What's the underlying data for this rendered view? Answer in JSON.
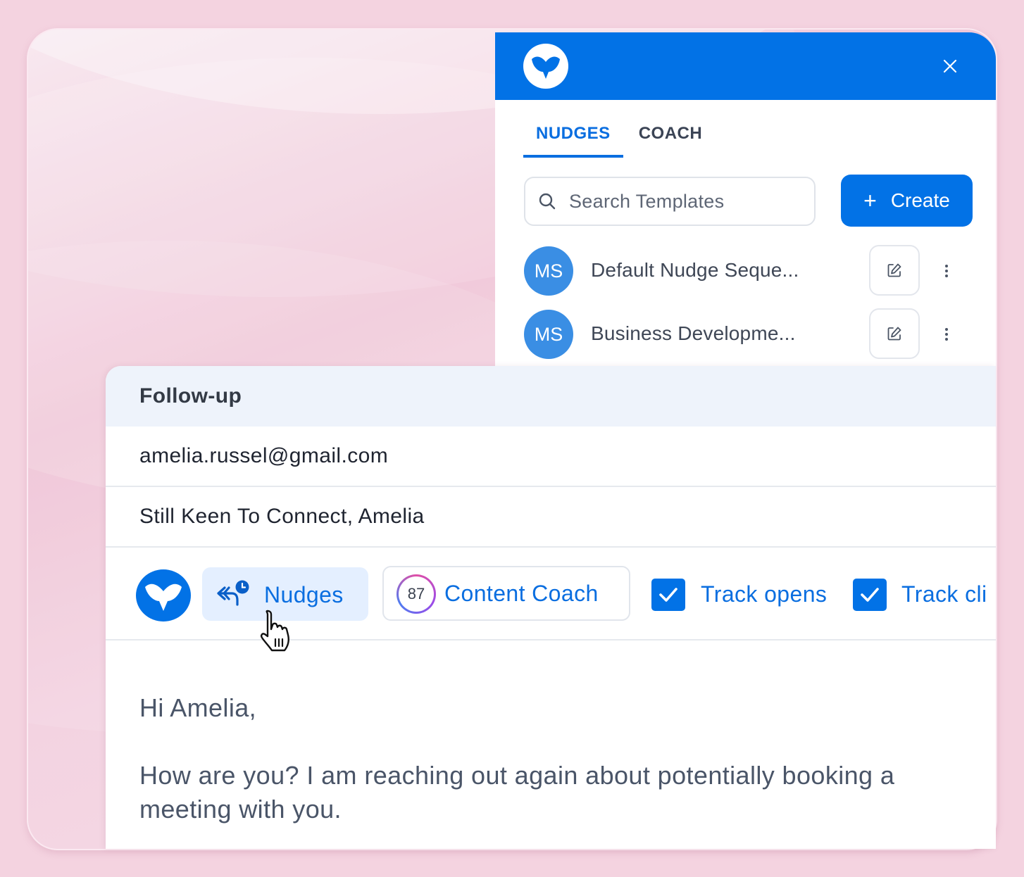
{
  "panel": {
    "close_icon": "close-icon",
    "tabs": [
      {
        "label": "NUDGES",
        "active": true
      },
      {
        "label": "COACH",
        "active": false
      }
    ],
    "search": {
      "placeholder": "Search Templates",
      "icon": "search-icon"
    },
    "create_button": {
      "plus": "+",
      "label": "Create"
    },
    "templates": [
      {
        "initials": "MS",
        "name": "Default Nudge Seque..."
      },
      {
        "initials": "MS",
        "name": "Business Developme..."
      }
    ]
  },
  "compose": {
    "title": "Follow-up",
    "to": "amelia.russel@gmail.com",
    "subject": "Still Keen To Connect, Amelia",
    "toolbar": {
      "nudges_label": "Nudges",
      "coach_score": "87",
      "coach_label": "Content Coach",
      "track_opens_label": "Track opens",
      "track_opens_checked": true,
      "track_clicks_label": "Track cli",
      "track_clicks_checked": true
    },
    "body": {
      "greeting": "Hi Amelia,",
      "paragraph": "How are you? I am reaching out again about potentially booking a meeting with you."
    }
  },
  "colors": {
    "brand_blue": "#0272e6",
    "link_blue": "#0a6ee0",
    "avatar_blue": "#3a8ee4",
    "background_pink": "#f4d3e0"
  }
}
